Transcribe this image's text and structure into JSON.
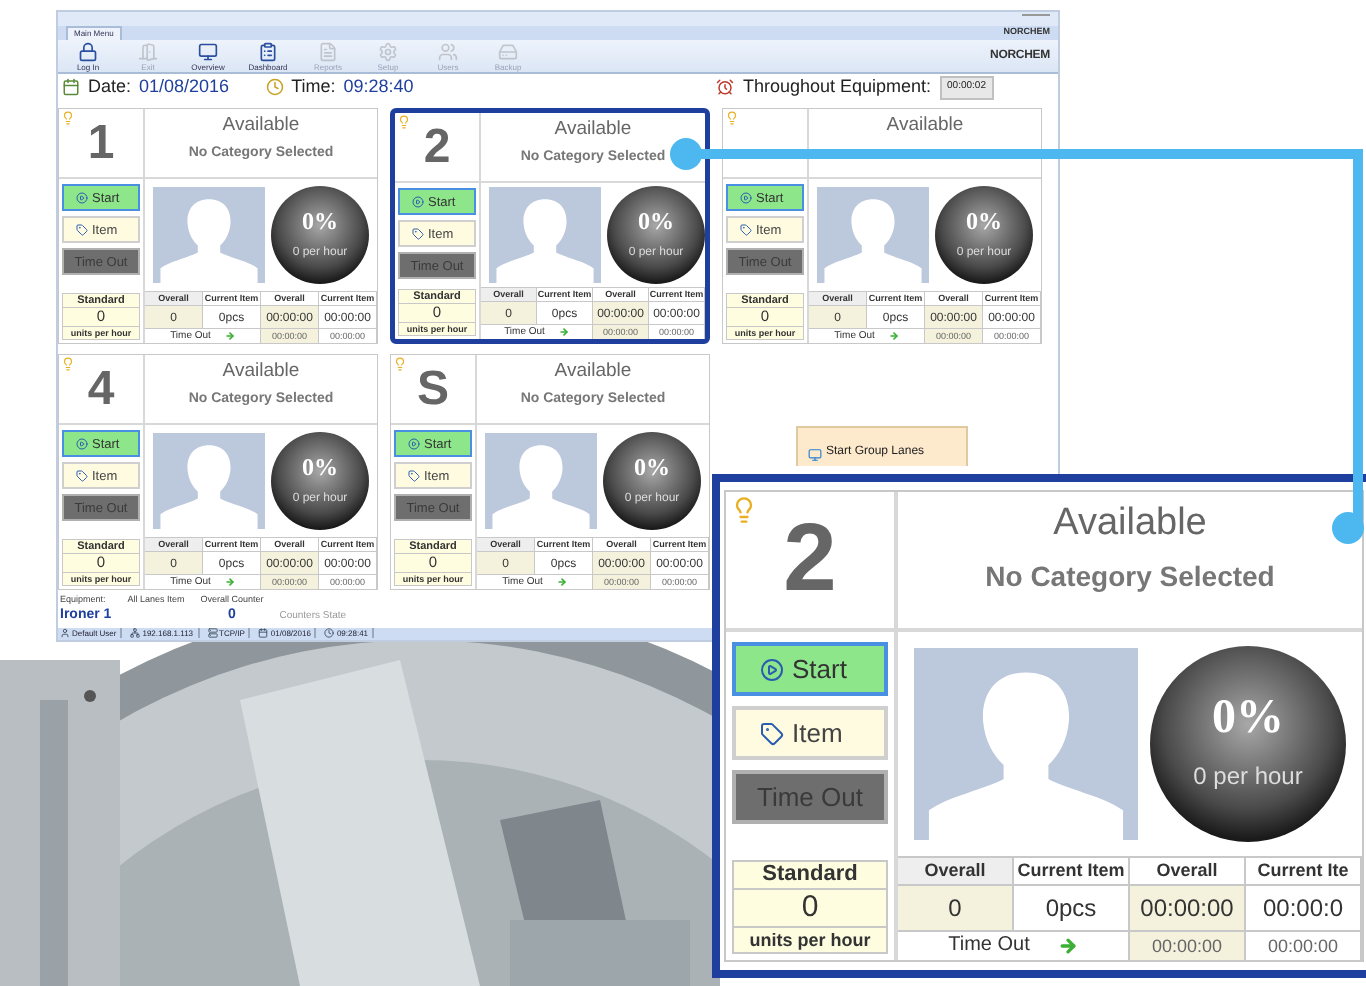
{
  "window": {
    "tab": "Main Menu",
    "brand": "NORCHEM",
    "logo": "NORCHEM",
    "toolbar": [
      {
        "label": "Log In",
        "kind": "lock",
        "disabled": false
      },
      {
        "label": "Exit",
        "kind": "exit",
        "disabled": true
      },
      {
        "label": "Overview",
        "kind": "monitor",
        "disabled": false
      },
      {
        "label": "Dashboard",
        "kind": "clipboard",
        "disabled": false
      },
      {
        "label": "Reports",
        "kind": "reports",
        "disabled": true
      },
      {
        "label": "Setup",
        "kind": "setup",
        "disabled": true
      },
      {
        "label": "Users",
        "kind": "users",
        "disabled": true
      },
      {
        "label": "Backup",
        "kind": "backup",
        "disabled": true
      }
    ]
  },
  "info_bar": {
    "date_label": "Date:",
    "date": "01/08/2016",
    "time_label": "Time:",
    "time": "09:28:40",
    "throughput_label": "Throughout Equipment:",
    "throughput": "00:00:02"
  },
  "lanes": [
    {
      "number": "1",
      "highlighted": false,
      "status": "Available",
      "subtitle": "No Category Selected",
      "buttons": [
        {
          "label": "Start",
          "kind": "start"
        },
        {
          "label": "Item",
          "kind": "item"
        },
        {
          "label": "Time Out",
          "kind": "timeout"
        }
      ],
      "standard": {
        "label": "Standard",
        "value": "0",
        "unit": "units per hour"
      },
      "gauge": {
        "percent": "0%",
        "rate": "0 per hour"
      },
      "table": {
        "headers": [
          "Overall",
          "Current Item",
          "Overall",
          "Current Item"
        ],
        "values": [
          "0",
          "0pcs",
          "00:00:00",
          "00:00:00"
        ],
        "timeout_label": "Time Out",
        "timeout_values": [
          "00:00:00",
          "00:00:00"
        ]
      }
    },
    {
      "number": "2",
      "highlighted": true,
      "status": "Available",
      "subtitle": "No Category Selected",
      "buttons": [
        {
          "label": "Start",
          "kind": "start"
        },
        {
          "label": "Item",
          "kind": "item"
        },
        {
          "label": "Time Out",
          "kind": "timeout"
        }
      ],
      "standard": {
        "label": "Standard",
        "value": "0",
        "unit": "units per hour"
      },
      "gauge": {
        "percent": "0%",
        "rate": "0 per hour"
      },
      "table": {
        "headers": [
          "Overall",
          "Current Item",
          "Overall",
          "Current Item"
        ],
        "values": [
          "0",
          "0pcs",
          "00:00:00",
          "00:00:00"
        ],
        "timeout_label": "Time Out",
        "timeout_values": [
          "00:00:00",
          "00:00:00"
        ]
      }
    },
    {
      "highlighted": false,
      "status": "Available",
      "buttons": [
        {
          "label": "Start",
          "kind": "start"
        },
        {
          "label": "Item",
          "kind": "item"
        },
        {
          "label": "Time Out",
          "kind": "timeout"
        }
      ],
      "standard": {
        "label": "Standard",
        "value": "0",
        "unit": "units per hour"
      },
      "gauge": {
        "percent": "0%",
        "rate": "0 per hour"
      },
      "table": {
        "headers": [
          "Overall",
          "Current Item",
          "Overall",
          "Current Item"
        ],
        "values": [
          "0",
          "0pcs",
          "00:00:00",
          "00:00:00"
        ],
        "timeout_label": "Time Out",
        "timeout_values": [
          "00:00:00",
          "00:00:00"
        ]
      }
    },
    {
      "number": "4",
      "highlighted": false,
      "status": "Available",
      "subtitle": "No Category Selected",
      "buttons": [
        {
          "label": "Start",
          "kind": "start"
        },
        {
          "label": "Item",
          "kind": "item"
        },
        {
          "label": "Time Out",
          "kind": "timeout"
        }
      ],
      "standard": {
        "label": "Standard",
        "value": "0",
        "unit": "units per hour"
      },
      "gauge": {
        "percent": "0%",
        "rate": "0 per hour"
      },
      "table": {
        "headers": [
          "Overall",
          "Current Item",
          "Overall",
          "Current Item"
        ],
        "values": [
          "0",
          "0pcs",
          "00:00:00",
          "00:00:00"
        ],
        "timeout_label": "Time Out",
        "timeout_values": [
          "00:00:00",
          "00:00:00"
        ]
      }
    },
    {
      "number": "S",
      "highlighted": false,
      "status": "Available",
      "subtitle": "No Category Selected",
      "buttons": [
        {
          "label": "Start",
          "kind": "start"
        },
        {
          "label": "Item",
          "kind": "item"
        },
        {
          "label": "Time Out",
          "kind": "timeout"
        }
      ],
      "standard": {
        "label": "Standard",
        "value": "0",
        "unit": "units per hour"
      },
      "gauge": {
        "percent": "0%",
        "rate": "0 per hour"
      },
      "table": {
        "headers": [
          "Overall",
          "Current Item",
          "Overall",
          "Current Item"
        ],
        "values": [
          "0",
          "0pcs",
          "00:00:00",
          "00:00:00"
        ],
        "timeout_label": "Time Out",
        "timeout_values": [
          "00:00:00",
          "00:00:00"
        ]
      }
    }
  ],
  "group_button": "Start Group Lanes",
  "counters": {
    "equipment_label": "Equipment:",
    "equipment": "Ironer 1",
    "items_label": "All Lanes Item",
    "counter_label": "Overall Counter",
    "counter": "0",
    "state_label": "Counters State"
  },
  "status_bar": [
    {
      "text": "Default User",
      "kind": "user"
    },
    {
      "text": "192.168.1.113",
      "kind": "network"
    },
    {
      "text": "TCP/IP",
      "kind": "protocol"
    },
    {
      "text": "01/08/2016",
      "kind": "date"
    },
    {
      "text": "09:28:41",
      "kind": "time"
    }
  ],
  "callout": {
    "lane": {
      "number": "2",
      "highlighted": false,
      "status": "Available",
      "subtitle": "No Category Selected",
      "buttons": [
        {
          "label": "Start",
          "kind": "start"
        },
        {
          "label": "Item",
          "kind": "item"
        },
        {
          "label": "Time Out",
          "kind": "timeout"
        }
      ],
      "standard": {
        "label": "Standard",
        "value": "0",
        "unit": "units per hour"
      },
      "gauge": {
        "percent": "0%",
        "rate": "0 per hour"
      },
      "table": {
        "headers": [
          "Overall",
          "Current Item",
          "Overall",
          "Current Ite"
        ],
        "values": [
          "0",
          "0pcs",
          "00:00:00",
          "00:00:0"
        ],
        "timeout_label": "Time Out",
        "timeout_values": [
          "00:00:00",
          "00:00:00"
        ]
      }
    }
  }
}
